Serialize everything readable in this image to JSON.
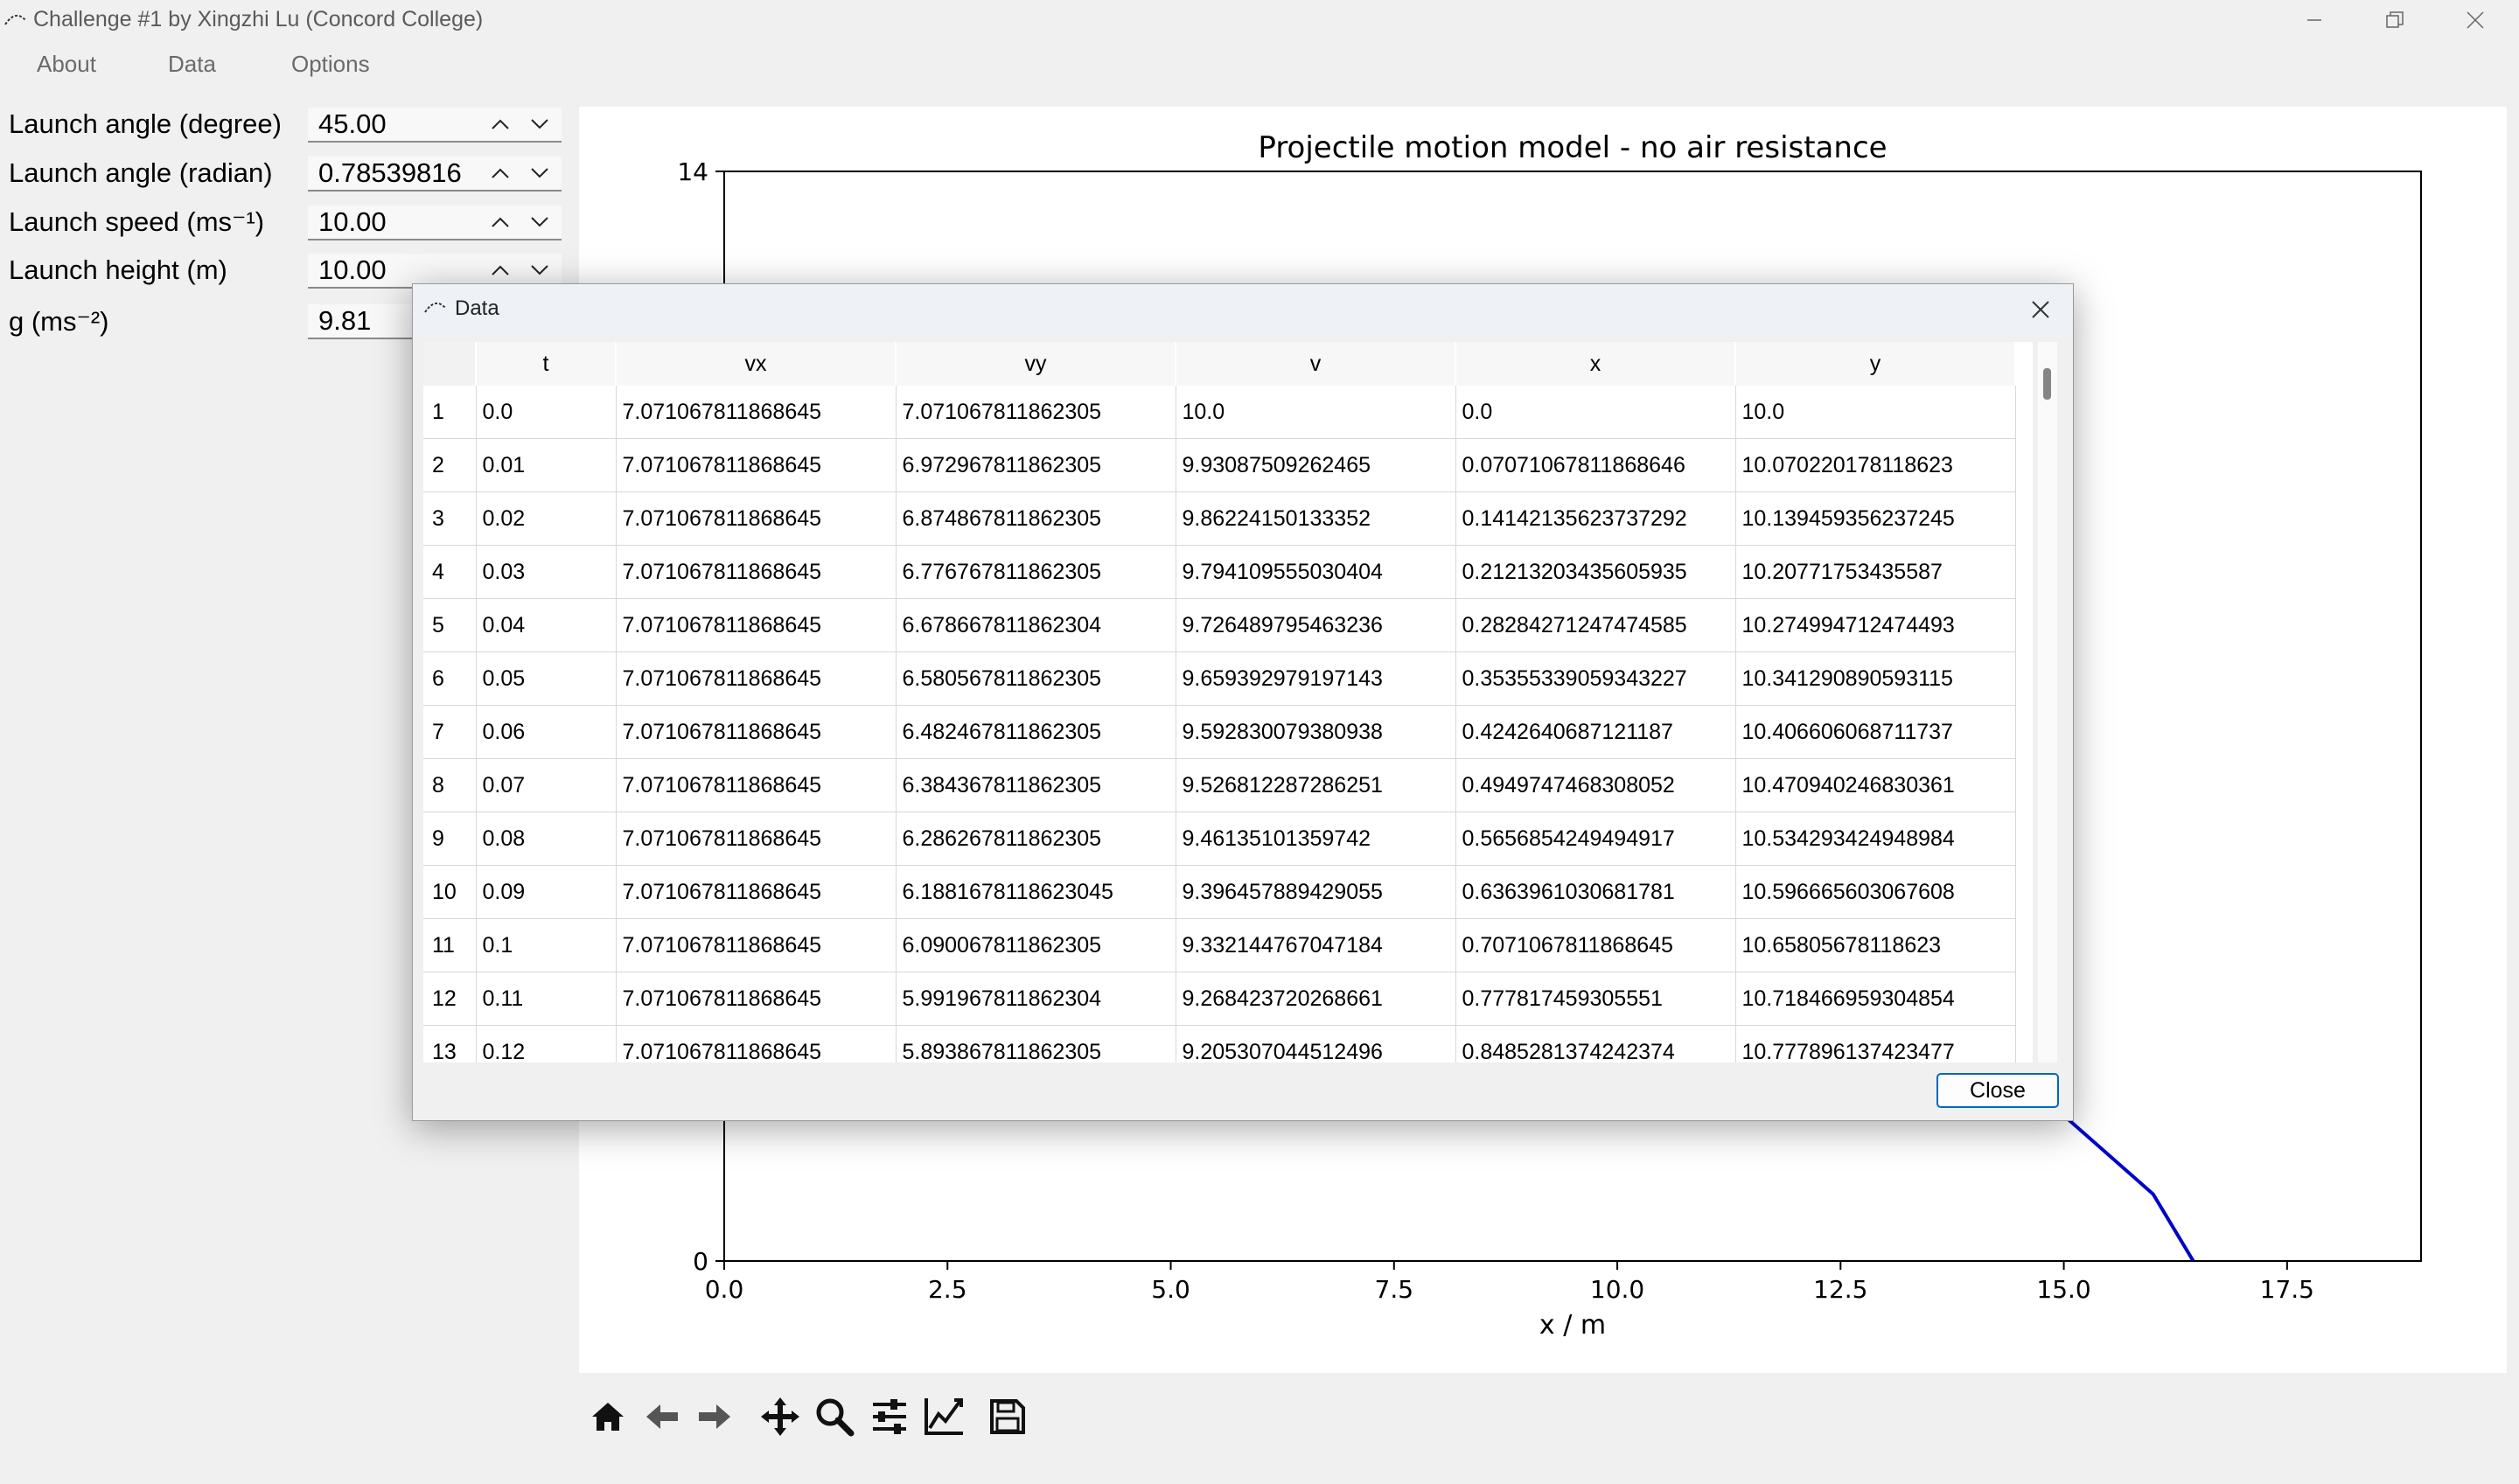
{
  "window": {
    "title": "Challenge #1 by Xingzhi Lu (Concord College)"
  },
  "menu": [
    "About",
    "Data",
    "Options"
  ],
  "params": [
    {
      "label": "Launch angle (degree)",
      "value": "45.00",
      "spin": true
    },
    {
      "label": "Launch angle (radian)",
      "value": "0.78539816",
      "spin": true
    },
    {
      "label": "Launch speed (ms⁻¹)",
      "value": "10.00",
      "spin": true
    },
    {
      "label": "Launch height (m)",
      "value": "10.00",
      "spin": true
    },
    {
      "label": "g (ms⁻²)",
      "value": "9.81",
      "spin": false
    }
  ],
  "plot": {
    "title": "Projectile motion model - no air resistance",
    "xlabel": "x / m",
    "x_ticks": [
      "0.0",
      "2.5",
      "5.0",
      "7.5",
      "10.0",
      "12.5",
      "15.0",
      "17.5"
    ],
    "y_ticks": [
      "14",
      "0"
    ],
    "line_color": "#0000cc"
  },
  "chart_data": {
    "type": "line",
    "title": "Projectile motion model - no air resistance",
    "xlabel": "x / m",
    "ylabel": "",
    "xlim": [
      0,
      19
    ],
    "ylim": [
      0,
      14
    ],
    "series": [
      {
        "x": [
          0.0,
          2.0,
          4.0,
          6.0,
          8.0,
          10.0,
          11.0,
          12.0,
          13.0,
          14.0,
          15.0,
          16.0,
          16.45
        ],
        "y": [
          10.0,
          11.61,
          12.43,
          12.47,
          11.72,
          10.19,
          9.03,
          7.64,
          5.96,
          3.91,
          1.87,
          0.86,
          0.0
        ]
      }
    ]
  },
  "toolbar": {
    "icons": [
      "home-icon",
      "back-icon",
      "forward-icon",
      "pan-icon",
      "zoom-icon",
      "configure-subplots-icon",
      "edit-axes-icon",
      "save-icon"
    ]
  },
  "dialog": {
    "title": "Data",
    "close_label": "Close",
    "columns": [
      "t",
      "vx",
      "vy",
      "v",
      "x",
      "y"
    ],
    "rows": [
      [
        "1",
        "0.0",
        "7.071067811868645",
        "7.071067811862305",
        "10.0",
        "0.0",
        "10.0"
      ],
      [
        "2",
        "0.01",
        "7.071067811868645",
        "6.972967811862305",
        "9.93087509262465",
        "0.07071067811868646",
        "10.070220178118623"
      ],
      [
        "3",
        "0.02",
        "7.071067811868645",
        "6.874867811862305",
        "9.86224150133352",
        "0.14142135623737292",
        "10.139459356237245"
      ],
      [
        "4",
        "0.03",
        "7.071067811868645",
        "6.776767811862305",
        "9.794109555030404",
        "0.21213203435605935",
        "10.20771753435587"
      ],
      [
        "5",
        "0.04",
        "7.071067811868645",
        "6.678667811862304",
        "9.726489795463236",
        "0.28284271247474585",
        "10.274994712474493"
      ],
      [
        "6",
        "0.05",
        "7.071067811868645",
        "6.580567811862305",
        "9.659392979197143",
        "0.35355339059343227",
        "10.341290890593115"
      ],
      [
        "7",
        "0.06",
        "7.071067811868645",
        "6.482467811862305",
        "9.592830079380938",
        "0.4242640687121187",
        "10.406606068711737"
      ],
      [
        "8",
        "0.07",
        "7.071067811868645",
        "6.384367811862305",
        "9.526812287286251",
        "0.4949747468308052",
        "10.470940246830361"
      ],
      [
        "9",
        "0.08",
        "7.071067811868645",
        "6.286267811862305",
        "9.46135101359742",
        "0.5656854249494917",
        "10.534293424948984"
      ],
      [
        "10",
        "0.09",
        "7.071067811868645",
        "6.1881678118623045",
        "9.396457889429055",
        "0.6363961030681781",
        "10.596665603067608"
      ],
      [
        "11",
        "0.1",
        "7.071067811868645",
        "6.090067811862305",
        "9.332144767047184",
        "0.7071067811868645",
        "10.65805678118623"
      ],
      [
        "12",
        "0.11",
        "7.071067811868645",
        "5.991967811862304",
        "9.268423720268661",
        "0.777817459305551",
        "10.718466959304854"
      ],
      [
        "13",
        "0.12",
        "7.071067811868645",
        "5.893867811862305",
        "9.205307044512496",
        "0.8485281374242374",
        "10.777896137423477"
      ]
    ]
  }
}
